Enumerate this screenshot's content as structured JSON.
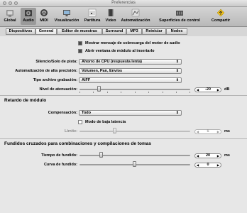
{
  "window": {
    "title": "Preferencias"
  },
  "toolbar": {
    "items": [
      {
        "label": "Global"
      },
      {
        "label": "Audio"
      },
      {
        "label": "MIDI"
      },
      {
        "label": "Visualización"
      },
      {
        "label": "Partitura"
      },
      {
        "label": "Vídeo"
      },
      {
        "label": "Automatización"
      },
      {
        "label": "Superficies de control"
      },
      {
        "label": "Compartir"
      }
    ]
  },
  "tabs": [
    {
      "label": "Dispositivos"
    },
    {
      "label": "General"
    },
    {
      "label": "Editor de muestras"
    },
    {
      "label": "Surround"
    },
    {
      "label": "MP3"
    },
    {
      "label": "Reiniciar"
    },
    {
      "label": "Nodes"
    }
  ],
  "general": {
    "show_overload_label": "Mostrar mensaje de sobrecarga del motor de audio",
    "show_overload_checked": true,
    "open_plugin_label": "Abrir ventana de módulo al insertarlo",
    "open_plugin_checked": true,
    "track_mute_solo_label": "Silencio/Solo de pista:",
    "track_mute_solo_value": "Ahorro de CPU (respuesta lenta)",
    "sample_accurate_label": "Automatización de alta precisión:",
    "sample_accurate_value": "Volumen, Pan, Envíos",
    "recording_file_label": "Tipo archivo grabación:",
    "recording_file_value": "AIFF",
    "dither_label": "Nivel de atenuación:",
    "dither_value": "-20",
    "dither_unit": "dB"
  },
  "plugin_delay": {
    "title": "Retardo de módulo",
    "compensation_label": "Compensación:",
    "compensation_value": "Todo",
    "low_latency_label": "Modo de baja latencia",
    "low_latency_checked": false,
    "limit_label": "Límite:",
    "limit_value": "5",
    "limit_unit": "ms"
  },
  "crossfades": {
    "title": "Fundidos cruzados para combinaciones y compilaciones de tomas",
    "time_label": "Tiempo de fundido:",
    "time_value": "20",
    "time_unit": "ms",
    "curve_label": "Curva de fundido:",
    "curve_value": "0"
  }
}
